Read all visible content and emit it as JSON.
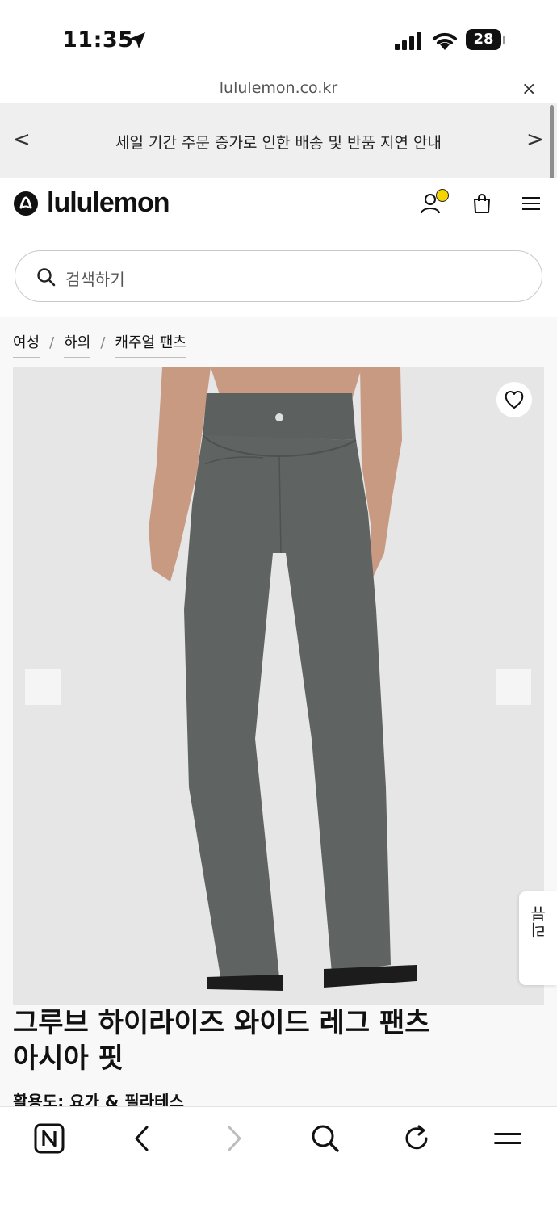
{
  "status_bar": {
    "time": "11:35",
    "battery": "28"
  },
  "browser": {
    "url": "lululemon.co.kr",
    "close_label": "×"
  },
  "announcement": {
    "prefix": "세일 기간 주문 증가로 인한 ",
    "link": "배송 및 반품 지연 안내",
    "prev": "<",
    "next": ">"
  },
  "header": {
    "logo_text": "lululemon"
  },
  "search": {
    "placeholder": "검색하기"
  },
  "breadcrumb": {
    "items": [
      "여성",
      "하의",
      "캐주얼 팬츠"
    ],
    "separator": "/"
  },
  "product": {
    "title_line1": "그루브 하이라이즈 와이드 레그 팬츠",
    "title_line2": "아시아 핏",
    "activity": "활용도: 요가 & 필라테스",
    "review_tab": "리뷰"
  },
  "colors": {
    "pants": "#5f6462",
    "photo_bg": "#e6e6e6",
    "notification_dot": "#f5d400"
  }
}
